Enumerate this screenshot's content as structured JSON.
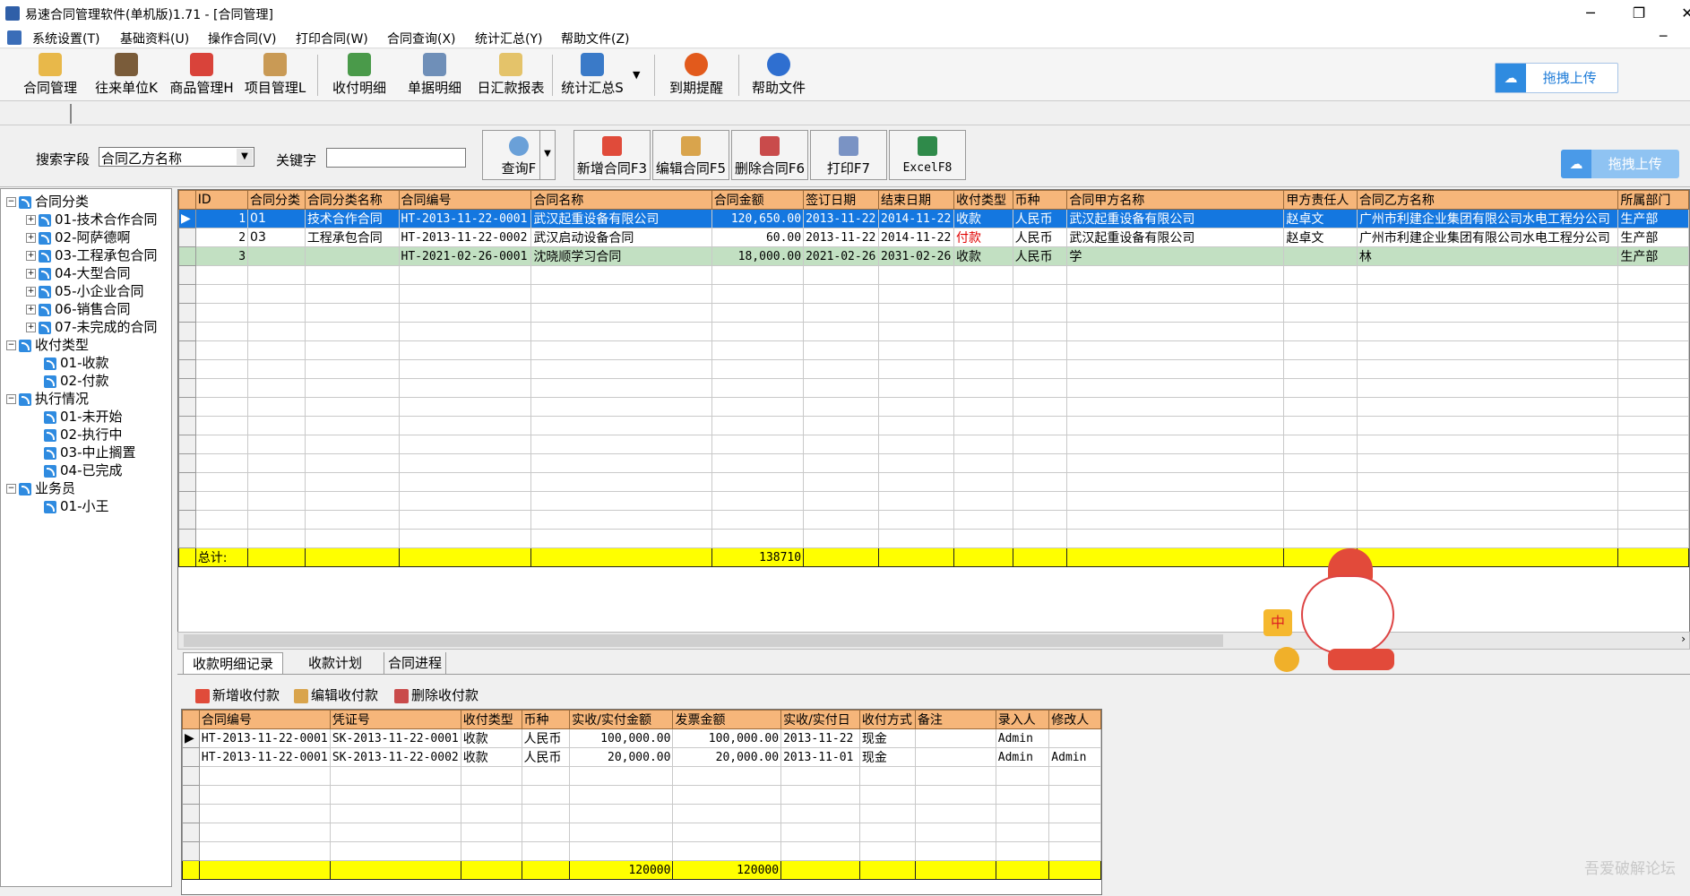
{
  "window": {
    "title": "易速合同管理软件(单机版)1.71 - [合同管理]"
  },
  "menubar": [
    "系统设置(T)",
    "基础资料(U)",
    "操作合同(V)",
    "打印合同(W)",
    "合同查询(X)",
    "统计汇总(Y)",
    "帮助文件(Z)"
  ],
  "toolbar": {
    "buttons": [
      "合同管理",
      "往来单位K",
      "商品管理H",
      "项目管理L",
      "收付明细",
      "单据明细",
      "日汇款报表",
      "统计汇总S",
      "到期提醒",
      "帮助文件"
    ],
    "upload": "拖拽上传"
  },
  "search": {
    "field_label": "搜索字段",
    "field_value": "合同乙方名称",
    "keyword_label": "关键字",
    "keyword_value": "",
    "query_btn": "查询F",
    "new_btn": "新增合同F3",
    "edit_btn": "编辑合同F5",
    "delete_btn": "删除合同F6",
    "print_btn": "打印F7",
    "excel_btn": "ExcelF8",
    "upload": "拖拽上传"
  },
  "tree": {
    "groups": [
      {
        "label": "合同分类",
        "items": [
          "01-技术合作合同",
          "02-阿萨德啊",
          "03-工程承包合同",
          "04-大型合同",
          "05-小企业合同",
          "06-销售合同",
          "07-未完成的合同"
        ]
      },
      {
        "label": "收付类型",
        "items": [
          "01-收款",
          "02-付款"
        ]
      },
      {
        "label": "执行情况",
        "items": [
          "01-未开始",
          "02-执行中",
          "03-中止搁置",
          "04-已完成"
        ]
      },
      {
        "label": "业务员",
        "items": [
          "01-小王"
        ]
      }
    ]
  },
  "main_grid": {
    "columns": [
      "ID",
      "合同分类",
      "合同分类名称",
      "合同编号",
      "合同名称",
      "合同金额",
      "签订日期",
      "结束日期",
      "收付类型",
      "币种",
      "合同甲方名称",
      "甲方责任人",
      "合同乙方名称",
      "所属部门"
    ],
    "rows": [
      [
        "1",
        "01",
        "技术合作合同",
        "HT-2013-11-22-0001",
        "武汉起重设备有限公司",
        "120,650.00",
        "2013-11-22",
        "2014-11-22",
        "收款",
        "人民币",
        "武汉起重设备有限公司",
        "赵卓文",
        "广州市利建企业集团有限公司水电工程分公司",
        "生产部"
      ],
      [
        "2",
        "03",
        "工程承包合同",
        "HT-2013-11-22-0002",
        "武汉启动设备合同",
        "60.00",
        "2013-11-22",
        "2014-11-22",
        "付款",
        "人民币",
        "武汉起重设备有限公司",
        "赵卓文",
        "广州市利建企业集团有限公司水电工程分公司",
        "生产部"
      ],
      [
        "3",
        "",
        "",
        "HT-2021-02-26-0001",
        "沈晓顺学习合同",
        "18,000.00",
        "2021-02-26",
        "2031-02-26",
        "收款",
        "人民币",
        "学",
        "",
        "林",
        "生产部"
      ]
    ],
    "total_label": "总计:",
    "total_amount": "138710"
  },
  "tabs": [
    "收款明细记录",
    "收款计划",
    "合同进程"
  ],
  "sub_toolbar": [
    "新增收付款",
    "编辑收付款",
    "删除收付款"
  ],
  "sub_grid": {
    "columns": [
      "合同编号",
      "凭证号",
      "收付类型",
      "币种",
      "实收/实付金额",
      "发票金额",
      "实收/实付日",
      "收付方式",
      "备注",
      "录入人",
      "修改人"
    ],
    "rows": [
      [
        "HT-2013-11-22-0001",
        "SK-2013-11-22-0001",
        "收款",
        "人民币",
        "100,000.00",
        "100,000.00",
        "2013-11-22",
        "现金",
        "",
        "Admin",
        ""
      ],
      [
        "HT-2013-11-22-0001",
        "SK-2013-11-22-0002",
        "收款",
        "人民币",
        "20,000.00",
        "20,000.00",
        "2013-11-01",
        "现金",
        "",
        "Admin",
        "Admin"
      ]
    ],
    "total_paid": "120000",
    "total_invoice": "120000"
  },
  "mascot_badges": [
    "中"
  ],
  "watermark": "吾爱破解论坛"
}
